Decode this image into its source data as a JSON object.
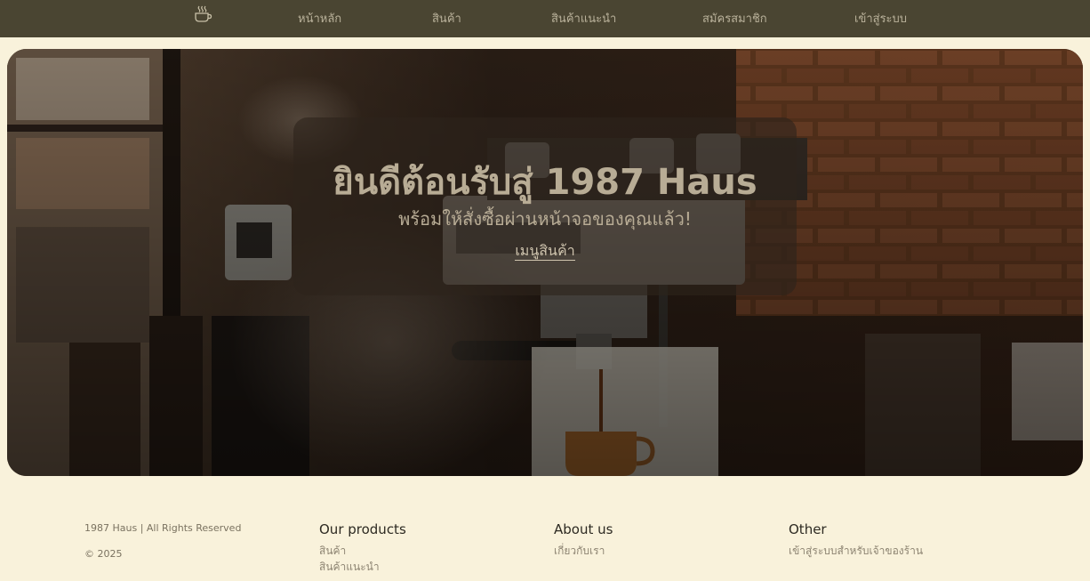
{
  "nav": {
    "logo_icon": "coffee-cup-icon",
    "items": [
      {
        "label": "หน้าหลัก"
      },
      {
        "label": "สินค้า"
      },
      {
        "label": "สินค้าแนะนำ"
      },
      {
        "label": "สมัครสมาชิก"
      },
      {
        "label": "เข้าสู่ระบบ"
      }
    ]
  },
  "hero": {
    "title": "ยินดีต้อนรับสู่ 1987 Haus",
    "subtitle": "พร้อมให้สั่งซื้อผ่านหน้าจอของคุณแล้ว!",
    "menu_link": "เมนูสินค้า"
  },
  "footer": {
    "copyright": "1987 Haus | All Rights Reserved",
    "year": "© 2025",
    "products": {
      "heading": "Our products",
      "links": [
        "สินค้า",
        "สินค้าแนะนำ"
      ]
    },
    "about": {
      "heading": "About us",
      "links": [
        "เกี่ยวกับเรา"
      ]
    },
    "other": {
      "heading": "Other",
      "links": [
        "เข้าสู่ระบบสำหรับเจ้าของร้าน"
      ]
    }
  },
  "colors": {
    "navbar_bg": "#4a4532",
    "page_bg": "#f9f2db",
    "nav_text": "#b9b19a",
    "hero_text": "#b8ac95"
  }
}
